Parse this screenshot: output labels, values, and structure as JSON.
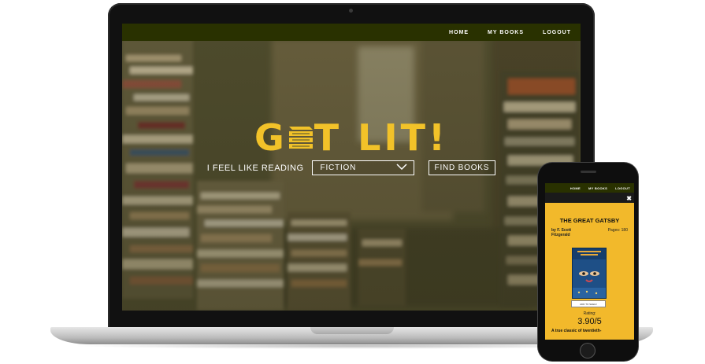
{
  "nav": {
    "home": "HOME",
    "my_books": "MY BOOKS",
    "logout": "LOGOUT"
  },
  "hero": {
    "logo_prefix": "G",
    "logo_suffix": "T LIT!",
    "feel_label": "I FEEL LIKE READING",
    "genre_selected": "FICTION",
    "find_button": "FIND BOOKS"
  },
  "phone": {
    "nav": {
      "home": "HOME",
      "my_books": "MY BOOKS",
      "logout": "LOGOUT"
    },
    "book": {
      "title": "THE GREAT GATSBY",
      "author": "by F. Scott Fitzgerald",
      "pages": "Pages: 180",
      "add_button": "ADD TO SHELF",
      "rating_label": "Rating:",
      "rating_value": "3.90/5",
      "description": "A true classic of twentieth-"
    }
  },
  "colors": {
    "accent": "#f2c229",
    "nav_bg": "#293100",
    "card_bg": "#f2b92b"
  }
}
